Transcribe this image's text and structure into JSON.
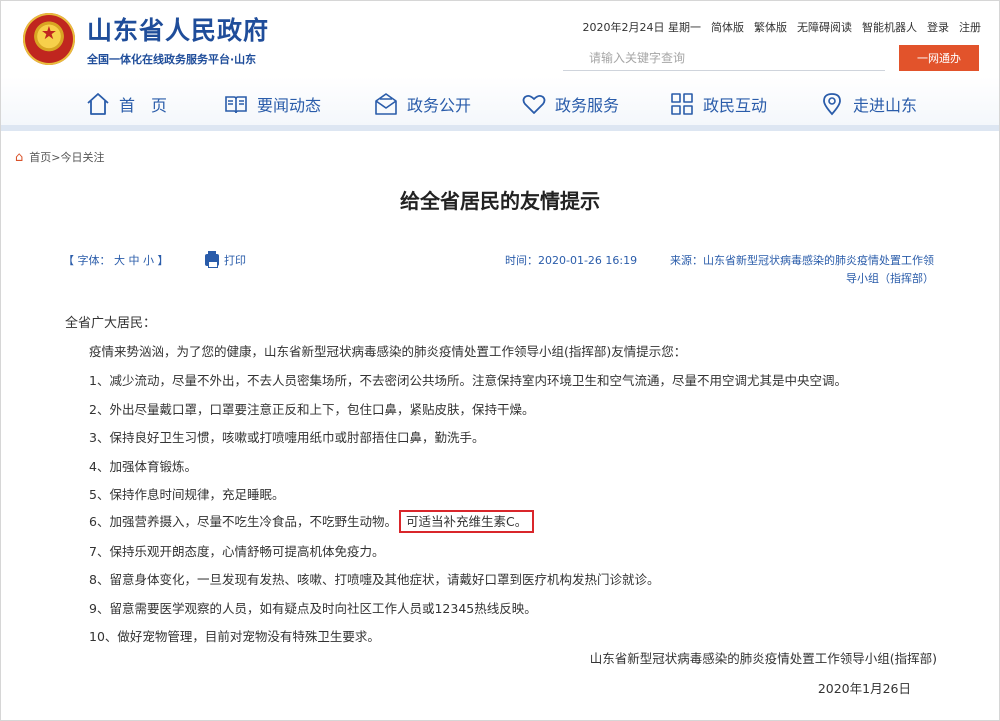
{
  "header": {
    "site_title": "山东省人民政府",
    "site_subtitle": "全国一体化在线政务服务平台·山东",
    "top_links": [
      "2020年2月24日 星期一",
      "简体版",
      "繁体版",
      "无障碍阅读",
      "智能机器人",
      "登录",
      "注册"
    ],
    "search_placeholder": "请输入关键字查询",
    "search_button": "一网通办"
  },
  "nav": {
    "items": [
      {
        "label": "首　页",
        "icon": "home-icon"
      },
      {
        "label": "要闻动态",
        "icon": "book-icon"
      },
      {
        "label": "政务公开",
        "icon": "mail-icon"
      },
      {
        "label": "政务服务",
        "icon": "heart-icon"
      },
      {
        "label": "政民互动",
        "icon": "chat-icon"
      },
      {
        "label": "走进山东",
        "icon": "map-pin-icon"
      }
    ]
  },
  "breadcrumb": "首页>今日关注",
  "article": {
    "title": "给全省居民的友情提示",
    "font_control": "【 字体： 大 中 小 】",
    "print_label": "打印",
    "time": "时间：2020-01-26 16:19",
    "source": "来源：山东省新型冠状病毒感染的肺炎疫情处置工作领导小组（指挥部）",
    "greeting": "全省广大居民：",
    "intro": "疫情来势汹汹，为了您的健康，山东省新型冠状病毒感染的肺炎疫情处置工作领导小组(指挥部)友情提示您：",
    "points": [
      "1、减少流动，尽量不外出，不去人员密集场所，不去密闭公共场所。注意保持室内环境卫生和空气流通，尽量不用空调尤其是中央空调。",
      "2、外出尽量戴口罩，口罩要注意正反和上下，包住口鼻，紧贴皮肤，保持干燥。",
      "3、保持良好卫生习惯，咳嗽或打喷嚏用纸巾或肘部捂住口鼻，勤洗手。",
      "4、加强体育锻炼。",
      "5、保持作息时间规律，充足睡眠。",
      "6、加强营养摄入，尽量不吃生冷食品，不吃野生动物。",
      "7、保持乐观开朗态度，心情舒畅可提高机体免疫力。",
      "8、留意身体变化，一旦发现有发热、咳嗽、打喷嚏及其他症状，请戴好口罩到医疗机构发热门诊就诊。",
      "9、留意需要医学观察的人员，如有疑点及时向社区工作人员或12345热线反映。",
      "10、做好宠物管理，目前对宠物没有特殊卫生要求。"
    ],
    "highlight": "可适当补充维生素C。",
    "signature": "山东省新型冠状病毒感染的肺炎疫情处置工作领导小组(指挥部)",
    "date": "2020年1月26日"
  },
  "colors": {
    "brand_blue": "#1f4d9a",
    "accent_red": "#e2532b",
    "highlight_border": "#d9262b"
  }
}
